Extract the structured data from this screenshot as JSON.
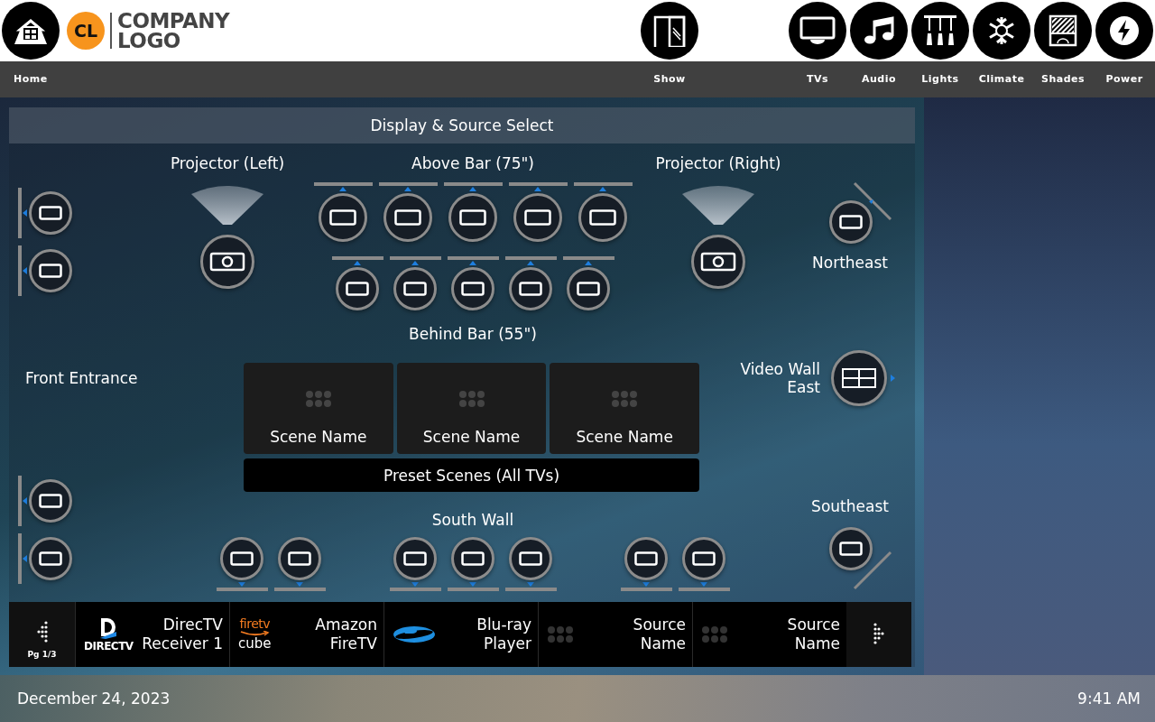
{
  "header": {
    "logo": {
      "badge": "CL",
      "lines": [
        "COMPANY",
        "LOGO"
      ]
    }
  },
  "nav": {
    "home": {
      "label": "Home",
      "kind": "home"
    },
    "items": [
      {
        "label": "Show",
        "kind": "show"
      },
      {
        "label": "TVs",
        "kind": "tvs"
      },
      {
        "label": "Audio",
        "kind": "audio"
      },
      {
        "label": "Lights",
        "kind": "lights"
      },
      {
        "label": "Climate",
        "kind": "climate"
      },
      {
        "label": "Shades",
        "kind": "shades"
      },
      {
        "label": "Power",
        "kind": "power"
      }
    ]
  },
  "panel": {
    "title": "Display & Source Select",
    "zones": [
      {
        "label": "Projector (Left)",
        "displays": [
          {
            "kind": "projector",
            "mount": {
              "kind": "ceiling"
            }
          }
        ]
      },
      {
        "label": "Above Bar (75\")",
        "displays": [
          {
            "kind": "tv",
            "mount": {
              "kind": "top"
            }
          },
          {
            "kind": "tv",
            "mount": {
              "kind": "top"
            }
          },
          {
            "kind": "tv",
            "mount": {
              "kind": "top"
            }
          },
          {
            "kind": "tv",
            "mount": {
              "kind": "top"
            }
          },
          {
            "kind": "tv",
            "mount": {
              "kind": "top"
            }
          }
        ]
      },
      {
        "label": "Projector (Right)",
        "displays": [
          {
            "kind": "projector",
            "mount": {
              "kind": "ceiling"
            }
          }
        ]
      },
      {
        "label": "Northeast",
        "displays": [
          {
            "kind": "tv",
            "mount": {
              "kind": "diagonalup"
            }
          }
        ]
      },
      {
        "label": "Behind Bar (55\")",
        "displays": [
          {
            "kind": "tv",
            "mount": {
              "kind": "top"
            }
          },
          {
            "kind": "tv",
            "mount": {
              "kind": "top"
            }
          },
          {
            "kind": "tv",
            "mount": {
              "kind": "top"
            }
          },
          {
            "kind": "tv",
            "mount": {
              "kind": "top"
            }
          },
          {
            "kind": "tv",
            "mount": {
              "kind": "top"
            }
          }
        ]
      },
      {
        "label": "Front Entrance",
        "displays": [
          {
            "kind": "tv",
            "mount": {
              "kind": "left"
            }
          },
          {
            "kind": "tv",
            "mount": {
              "kind": "left"
            }
          },
          {
            "kind": "tv",
            "mount": {
              "kind": "left"
            }
          },
          {
            "kind": "tv",
            "mount": {
              "kind": "left"
            }
          }
        ]
      },
      {
        "label": "Video Wall East",
        "displays": [
          {
            "kind": "videowall",
            "mount": {
              "kind": "right"
            }
          }
        ]
      },
      {
        "label": "South Wall",
        "displays": [
          {
            "kind": "tv",
            "mount": {
              "kind": "bottom"
            }
          },
          {
            "kind": "tv",
            "mount": {
              "kind": "bottom"
            }
          },
          {
            "kind": "tv",
            "mount": {
              "kind": "bottom"
            }
          },
          {
            "kind": "tv",
            "mount": {
              "kind": "bottom"
            }
          },
          {
            "kind": "tv",
            "mount": {
              "kind": "bottom"
            }
          },
          {
            "kind": "tv",
            "mount": {
              "kind": "bottom"
            }
          },
          {
            "kind": "tv",
            "mount": {
              "kind": "bottom"
            }
          }
        ]
      },
      {
        "label": "Southeast",
        "displays": [
          {
            "kind": "tv",
            "mount": {
              "kind": "diagonaldown"
            }
          }
        ]
      }
    ],
    "scenes": {
      "items": [
        {
          "label": "Scene Name"
        },
        {
          "label": "Scene Name"
        },
        {
          "label": "Scene Name"
        }
      ],
      "preset": "Preset Scenes (All TVs)"
    }
  },
  "sources": {
    "page": "Pg 1/3",
    "items": [
      {
        "kind": "directv",
        "logo_text": [
          "DIRECTV"
        ],
        "name": [
          "DirecTV",
          "Receiver 1"
        ]
      },
      {
        "kind": "firetv",
        "logo_text": [
          "firetv",
          "cube"
        ],
        "name": [
          "Amazon",
          "FireTV"
        ]
      },
      {
        "kind": "bluray",
        "name": [
          "Blu-ray",
          "Player"
        ]
      },
      {
        "kind": "generic",
        "name": [
          "Source",
          "Name"
        ]
      },
      {
        "kind": "generic",
        "name": [
          "Source",
          "Name"
        ]
      }
    ]
  },
  "status_bar": {
    "date": "December 24, 2023",
    "time": "9:41 AM"
  }
}
